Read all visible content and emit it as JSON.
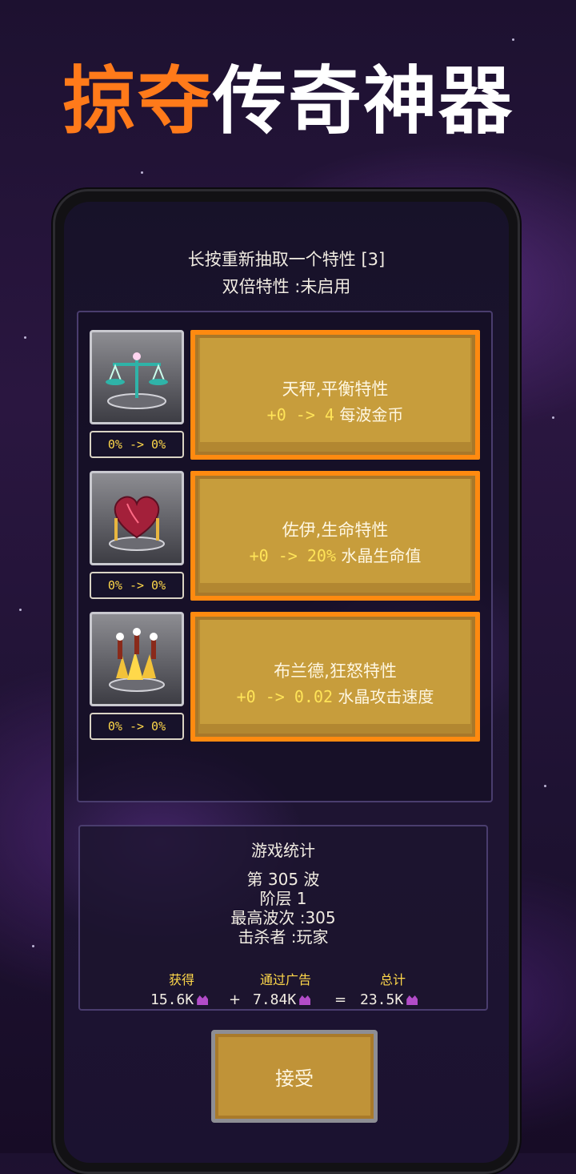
{
  "promo": {
    "title_highlight": "掠夺",
    "title_rest": "传奇神器"
  },
  "header": {
    "reroll_hint": "长按重新抽取一个特性 [3]",
    "double_trait": "双倍特性 :未启用"
  },
  "traits": [
    {
      "name": "天秤,平衡特性",
      "delta": "+0 -> 4",
      "effect": "每波金币",
      "percent": "0% -> 0%",
      "icon": "scales-icon"
    },
    {
      "name": "佐伊,生命特性",
      "delta": "+0 -> 20%",
      "effect": "水晶生命值",
      "percent": "0% -> 0%",
      "icon": "heart-icon"
    },
    {
      "name": "布兰德,狂怒特性",
      "delta": "+0 -> 0.02",
      "effect": "水晶攻击速度",
      "percent": "0% -> 0%",
      "icon": "crystal-fire-icon"
    }
  ],
  "stats": {
    "title": "游戏统计",
    "wave": "第 305 波",
    "tier": "阶层 1",
    "best_wave": "最高波次 :305",
    "killed_by": "击杀者 :玩家",
    "earned_label": "获得",
    "ad_label": "通过广告",
    "total_label": "总计",
    "earned_value": "15.6K",
    "ad_value": "7.84K",
    "total_value": "23.5K",
    "plus": "+",
    "equals": "="
  },
  "accept_label": "接受",
  "colors": {
    "highlight": "#ff7a1a",
    "card_gold": "#c79d3c",
    "card_border": "#ff8a10",
    "delta_yellow": "#ffe458",
    "gem_purple": "#b24cc8"
  }
}
